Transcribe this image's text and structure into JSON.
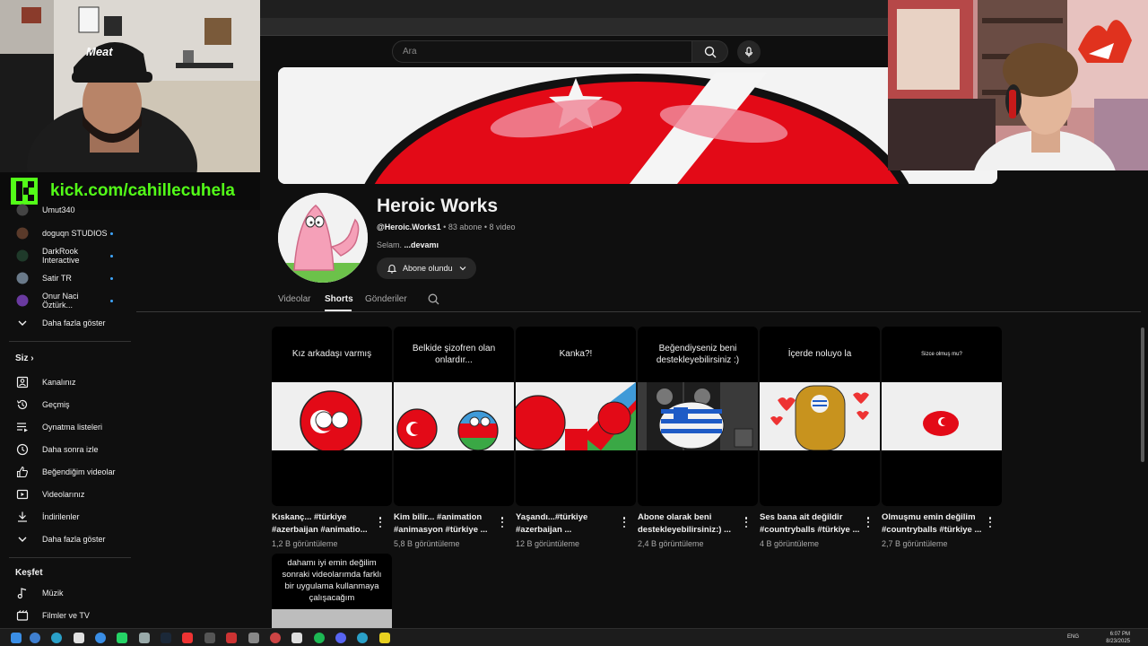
{
  "search": {
    "placeholder": "Ara",
    "icon": "search-icon",
    "mic_icon": "mic-icon"
  },
  "stream_overlay": {
    "kick_url": "kick.com/cahillecuhela",
    "cap_text": "Meat"
  },
  "sidebar": {
    "subscriptions": [
      {
        "label": "Umut340",
        "dot": false
      },
      {
        "label": "doguqn STUDIOS",
        "dot": true
      },
      {
        "label": "DarkRook Interactive",
        "dot": true
      },
      {
        "label": "Satir TR",
        "dot": true
      },
      {
        "label": "Onur Naci Öztürk...",
        "dot": true
      },
      {
        "label": "Daha fazla göster",
        "dot": false
      }
    ],
    "siz_heading": "Siz",
    "siz_items": [
      {
        "label": "Kanalınız",
        "icon": "channel-icon"
      },
      {
        "label": "Geçmiş",
        "icon": "history-icon"
      },
      {
        "label": "Oynatma listeleri",
        "icon": "playlists-icon"
      },
      {
        "label": "Daha sonra izle",
        "icon": "clock-icon"
      },
      {
        "label": "Beğendiğim videolar",
        "icon": "thumbs-up-icon"
      },
      {
        "label": "Videolarınız",
        "icon": "video-icon"
      },
      {
        "label": "İndirilenler",
        "icon": "download-icon"
      },
      {
        "label": "Daha fazla göster",
        "icon": "chevron-down-icon"
      }
    ],
    "kesfet_heading": "Keşfet",
    "kesfet_items": [
      {
        "label": "Müzik",
        "icon": "music-icon"
      },
      {
        "label": "Filmler ve TV",
        "icon": "film-icon"
      }
    ]
  },
  "channel": {
    "title": "Heroic Works",
    "handle": "@Heroic.Works1",
    "subscribers": "83 abone",
    "videos": "8 video",
    "description": "Selam.",
    "more_link": "...devamı",
    "subscribe_label": "Abone olundu"
  },
  "tabs": [
    {
      "label": "Videolar",
      "active": false
    },
    {
      "label": "Shorts",
      "active": true
    },
    {
      "label": "Gönderiler",
      "active": false
    }
  ],
  "shorts": [
    {
      "caption": "Kız arkadaşı varmış",
      "title": "Kıskanç... #türkiye #azerbaijan #animatio...",
      "views": "1,2 B görüntüleme"
    },
    {
      "caption": "Belkide şizofren olan onlardır...",
      "title": "Kim bilir... #animation #animasyon #türkiye ...",
      "views": "5,8 B görüntüleme"
    },
    {
      "caption": "Kanka?!",
      "title": "Yaşandı...#türkiye #azerbaijan ...",
      "views": "12 B görüntüleme"
    },
    {
      "caption": "Beğendiyseniz beni destekleyebilirsiniz :)",
      "title": "Abone olarak beni destekleyebilirsiniz:) ...",
      "views": "2,4 B görüntüleme"
    },
    {
      "caption": "İçerde noluyo la",
      "title": "Ses bana ait değildir #countryballs #türkiye ...",
      "views": "4 B görüntüleme"
    },
    {
      "caption": "Sizce olmuş mu?",
      "title": "Olmuşmu emin değilim #countryballs #türkiye ...",
      "views": "2,7 B görüntüleme"
    }
  ],
  "partial_short": {
    "caption": "dahamı iyi emin değilim sonraki videolarımda farklı bir uygulama kullanmaya çalışacağım"
  },
  "taskbar": {
    "lang": "ENG",
    "time": "6:07 PM",
    "date": "8/23/2025"
  },
  "colors": {
    "turkey_red": "#e30a17",
    "azer_blue": "#3f9ad8",
    "azer_green": "#3aa845",
    "accent_blue": "#3ea6ff",
    "kick_green": "#53fc18"
  }
}
